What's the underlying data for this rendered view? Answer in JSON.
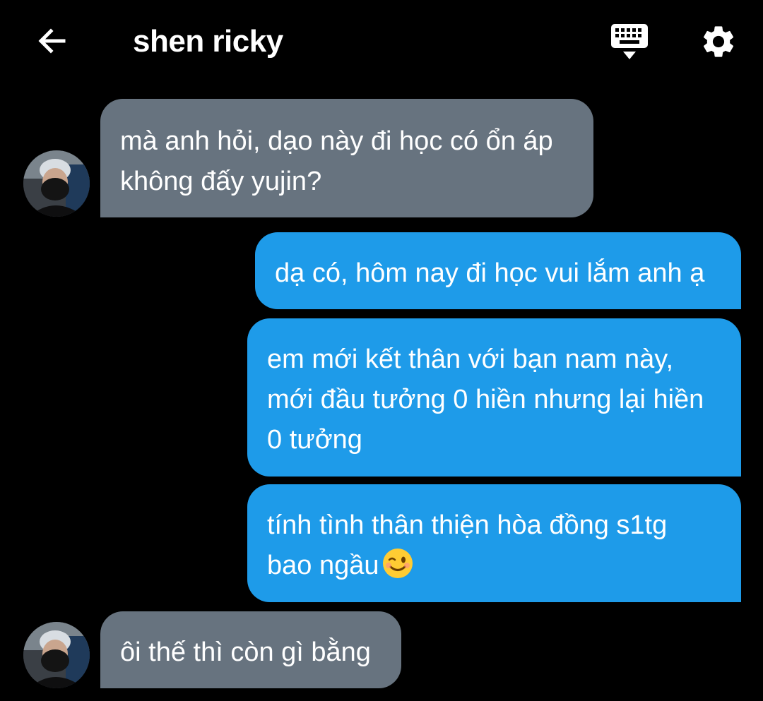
{
  "header": {
    "title": "shen ricky",
    "back_icon": "arrow-left-icon",
    "keyboard_icon": "keyboard-icon",
    "settings_icon": "gear-icon"
  },
  "colors": {
    "background": "#000000",
    "incoming_bubble": "#67737f",
    "outgoing_bubble": "#1e9be9",
    "text": "#ffffff"
  },
  "messages": [
    {
      "direction": "incoming",
      "lines": [
        "mà anh hỏi, dạo này đi học có ổn áp",
        "không đấy yujin?"
      ]
    },
    {
      "direction": "outgoing",
      "lines": [
        "dạ có, hôm nay đi học vui lắm anh ạ"
      ]
    },
    {
      "direction": "outgoing",
      "lines": [
        "em mới kết thân với bạn nam này,",
        "mới đầu tưởng 0 hiền nhưng lại hiền",
        "0 tưởng"
      ]
    },
    {
      "direction": "outgoing",
      "lines": [
        "tính tình thân thiện hòa đồng s1tg",
        "bao ngầu"
      ],
      "emoji": "winking-face-emoji"
    },
    {
      "direction": "incoming",
      "lines": [
        "ôi thế thì còn gì bằng"
      ]
    }
  ]
}
